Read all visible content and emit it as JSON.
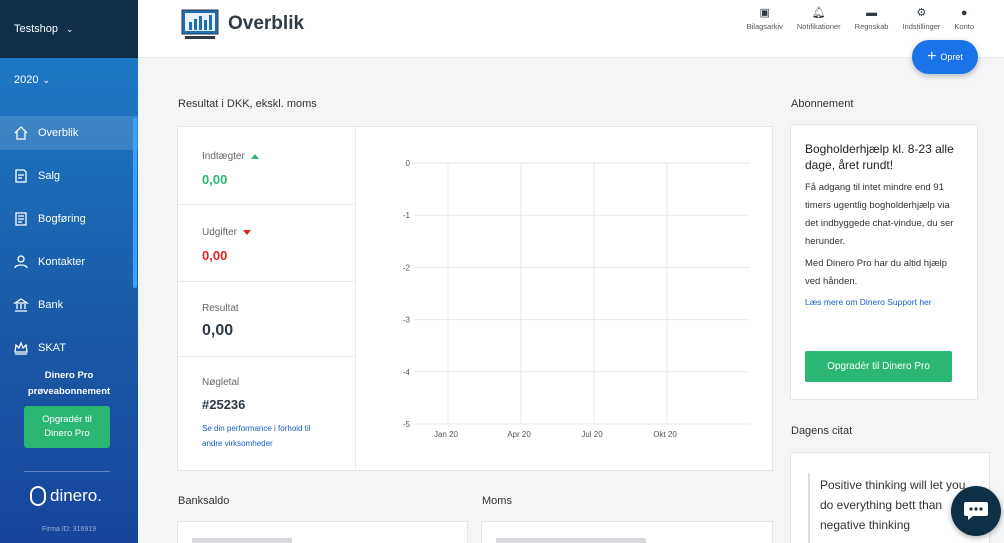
{
  "sidebar": {
    "company": "Testshop",
    "year": "2020",
    "items": [
      {
        "label": "Overblik",
        "icon": "home-icon"
      },
      {
        "label": "Salg",
        "icon": "sales-icon"
      },
      {
        "label": "Bogføring",
        "icon": "ledger-icon"
      },
      {
        "label": "Kontakter",
        "icon": "contacts-icon"
      },
      {
        "label": "Bank",
        "icon": "bank-icon"
      },
      {
        "label": "SKAT",
        "icon": "crown-icon"
      }
    ],
    "trial_line1": "Dinero Pro",
    "trial_line2": "prøveabonnement",
    "upgrade_label": "Opgradér til Dinero Pro",
    "logo_text": "dinero.",
    "firma_id": "Firma ID: 316919"
  },
  "header": {
    "title": "Overblik",
    "nav": [
      {
        "label": "Bilagsarkiv",
        "icon": "archive-icon"
      },
      {
        "label": "Notifikationer",
        "icon": "bell-icon"
      },
      {
        "label": "Regnskab",
        "icon": "folder-icon"
      },
      {
        "label": "Indstillinger",
        "icon": "gear-icon"
      },
      {
        "label": "Konto",
        "icon": "user-icon"
      }
    ],
    "create_label": "Opret"
  },
  "result": {
    "section_title": "Resultat i DKK, ekskl. moms",
    "income_label": "Indtægter",
    "income_value": "0,00",
    "expenses_label": "Udgifter",
    "expenses_value": "0,00",
    "result_label": "Resultat",
    "result_value": "0,00",
    "keyfig_label": "Nøgletal",
    "keyfig_value": "#25236",
    "keyfig_link": "Se din performance i forhold til andre virksomheder"
  },
  "chart_data": {
    "type": "line",
    "categories": [
      "Jan 20",
      "Apr 20",
      "Jul 20",
      "Okt 20"
    ],
    "yticks": [
      "0",
      "-1",
      "-2",
      "-3",
      "-4",
      "-5"
    ],
    "ylim": [
      -5,
      0
    ],
    "series": [],
    "grid": true
  },
  "subscription": {
    "section_title": "Abonnement",
    "heading": "Bogholderhjælp kl. 8-23 alle dage, året rundt!",
    "text1": "Få adgang til intet mindre end 91 timers ugentlig bogholderhjælp via det indbyggede chat-vindue, du ser herunder.",
    "text2": "Med Dinero Pro har du altid hjælp ved hånden.",
    "link": "Læs mere om Dinero Support her",
    "button": "Opgradér til Dinero Pro"
  },
  "quote": {
    "section_title": "Dagens citat",
    "text": "Positive thinking will let you do everything bett than negative thinking"
  },
  "bank": {
    "section_title": "Banksaldo"
  },
  "moms": {
    "section_title": "Moms"
  },
  "colors": {
    "green": "#2bb673",
    "red": "#e02424",
    "blue": "#1a73e8",
    "link": "#1a5fc4"
  }
}
